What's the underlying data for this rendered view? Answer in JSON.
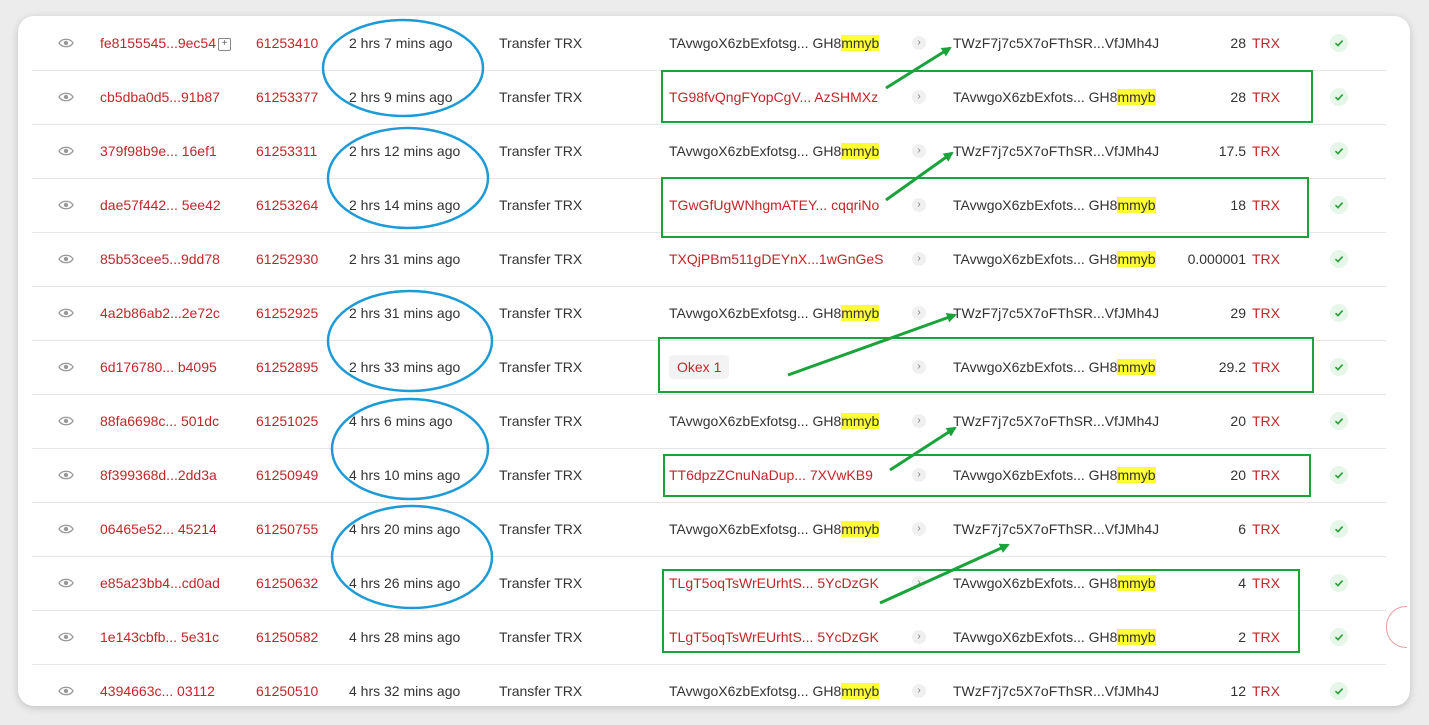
{
  "colors": {
    "link": "#c2262a",
    "highlight": "#ffff33",
    "ellipse": "#1e9bd7",
    "box": "#1aa33a",
    "arrow": "#1aa33a",
    "success": "#2a9d3a"
  },
  "icons": {
    "view": "eye-icon",
    "copy": "copy-icon",
    "direction": "chevron-right-icon",
    "status": "check-circle-icon"
  },
  "rows": [
    {
      "hash": "fe8155545...9ec54",
      "copy": true,
      "block": "61253410",
      "age": "2 hrs 7 mins ago",
      "type": "Transfer TRX",
      "from": {
        "pre": "TAvwgoX6zbExfotsg... GH8",
        "hl": "mmyb",
        "style": "plain"
      },
      "to": {
        "text": "TWzF7j7c5X7oFThSR...VfJMh4J",
        "hl": "",
        "style": "red"
      },
      "amount": "28",
      "unit": "TRX"
    },
    {
      "hash": "cb5dba0d5...91b87",
      "block": "61253377",
      "age": "2 hrs 9 mins ago",
      "type": "Transfer TRX",
      "from": {
        "pre": "TG98fvQngFYopCgV... AzSHMXz",
        "hl": "",
        "style": "red"
      },
      "to": {
        "text": "TAvwgoX6zbExfots... GH8",
        "hl": "mmyb",
        "style": "plain"
      },
      "amount": "28",
      "unit": "TRX"
    },
    {
      "hash": "379f98b9e... 16ef1",
      "block": "61253311",
      "age": "2 hrs 12 mins ago",
      "type": "Transfer TRX",
      "from": {
        "pre": "TAvwgoX6zbExfotsg... GH8",
        "hl": "mmyb",
        "style": "plain"
      },
      "to": {
        "text": "TWzF7j7c5X7oFThSR...VfJMh4J",
        "hl": "",
        "style": "red"
      },
      "amount": "17.5",
      "unit": "TRX"
    },
    {
      "hash": "dae57f442... 5ee42",
      "block": "61253264",
      "age": "2 hrs 14 mins ago",
      "type": "Transfer TRX",
      "from": {
        "pre": "TGwGfUgWNhgmATEY... cqqriNo",
        "hl": "",
        "style": "red"
      },
      "to": {
        "text": "TAvwgoX6zbExfots... GH8",
        "hl": "mmyb",
        "style": "plain"
      },
      "amount": "18",
      "unit": "TRX"
    },
    {
      "hash": "85b53cee5...9dd78",
      "block": "61252930",
      "age": "2 hrs 31 mins ago",
      "type": "Transfer TRX",
      "from": {
        "pre": "TXQjPBm511gDEYnX...1wGnGeS",
        "hl": "",
        "style": "red"
      },
      "to": {
        "text": "TAvwgoX6zbExfots... GH8",
        "hl": "mmyb",
        "style": "plain"
      },
      "amount": "0.000001",
      "unit": "TRX"
    },
    {
      "hash": "4a2b86ab2...2e72c",
      "block": "61252925",
      "age": "2 hrs 31 mins ago",
      "type": "Transfer TRX",
      "from": {
        "pre": "TAvwgoX6zbExfotsg... GH8",
        "hl": "mmyb",
        "style": "plain"
      },
      "to": {
        "text": "TWzF7j7c5X7oFThSR...VfJMh4J",
        "hl": "",
        "style": "red"
      },
      "amount": "29",
      "unit": "TRX"
    },
    {
      "hash": "6d176780... b4095",
      "block": "61252895",
      "age": "2 hrs 33 mins ago",
      "type": "Transfer TRX",
      "from": {
        "pre": "Okex 1",
        "hl": "",
        "style": "tag"
      },
      "to": {
        "text": "TAvwgoX6zbExfots... GH8",
        "hl": "mmyb",
        "style": "plain"
      },
      "amount": "29.2",
      "unit": "TRX"
    },
    {
      "hash": "88fa6698c... 501dc",
      "block": "61251025",
      "age": "4 hrs 6 mins ago",
      "type": "Transfer TRX",
      "from": {
        "pre": "TAvwgoX6zbExfotsg... GH8",
        "hl": "mmyb",
        "style": "plain"
      },
      "to": {
        "text": "TWzF7j7c5X7oFThSR...VfJMh4J",
        "hl": "",
        "style": "red"
      },
      "amount": "20",
      "unit": "TRX"
    },
    {
      "hash": "8f399368d...2dd3a",
      "block": "61250949",
      "age": "4 hrs 10 mins ago",
      "type": "Transfer TRX",
      "from": {
        "pre": "TT6dpzZCnuNaDup... 7XVwKB9",
        "hl": "",
        "style": "red"
      },
      "to": {
        "text": "TAvwgoX6zbExfots... GH8",
        "hl": "mmyb",
        "style": "plain"
      },
      "amount": "20",
      "unit": "TRX"
    },
    {
      "hash": "06465e52... 45214",
      "block": "61250755",
      "age": "4 hrs 20 mins ago",
      "type": "Transfer TRX",
      "from": {
        "pre": "TAvwgoX6zbExfotsg... GH8",
        "hl": "mmyb",
        "style": "plain"
      },
      "to": {
        "text": "TWzF7j7c5X7oFThSR...VfJMh4J",
        "hl": "",
        "style": "red"
      },
      "amount": "6",
      "unit": "TRX"
    },
    {
      "hash": "e85a23bb4...cd0ad",
      "block": "61250632",
      "age": "4 hrs 26 mins ago",
      "type": "Transfer TRX",
      "from": {
        "pre": "TLgT5oqTsWrEUrhtS... 5YcDzGK",
        "hl": "",
        "style": "red"
      },
      "to": {
        "text": "TAvwgoX6zbExfots... GH8",
        "hl": "mmyb",
        "style": "plain"
      },
      "amount": "4",
      "unit": "TRX"
    },
    {
      "hash": "1e143cbfb... 5e31c",
      "block": "61250582",
      "age": "4 hrs 28 mins ago",
      "type": "Transfer TRX",
      "from": {
        "pre": "TLgT5oqTsWrEUrhtS... 5YcDzGK",
        "hl": "",
        "style": "red"
      },
      "to": {
        "text": "TAvwgoX6zbExfots... GH8",
        "hl": "mmyb",
        "style": "plain"
      },
      "amount": "2",
      "unit": "TRX"
    },
    {
      "hash": "4394663c... 03112",
      "block": "61250510",
      "age": "4 hrs 32 mins ago",
      "type": "Transfer TRX",
      "from": {
        "pre": "TAvwgoX6zbExfotsg... GH8",
        "hl": "mmyb",
        "style": "plain"
      },
      "to": {
        "text": "TWzF7j7c5X7oFThSR...VfJMh4J",
        "hl": "",
        "style": "red"
      },
      "amount": "12",
      "unit": "TRX"
    }
  ]
}
